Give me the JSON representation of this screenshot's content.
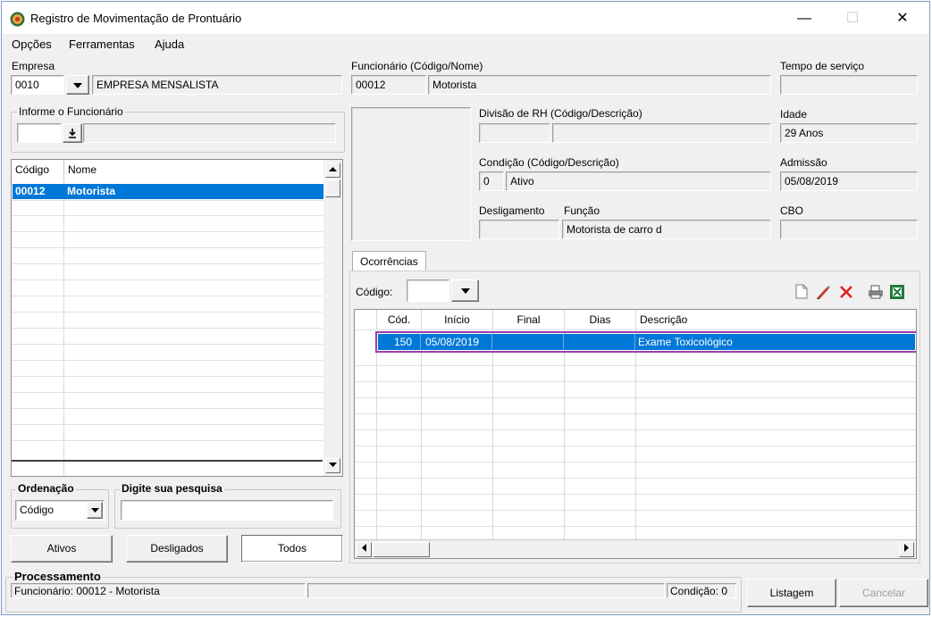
{
  "window": {
    "title": "Registro de Movimentação de Prontuário",
    "minimize": "—",
    "maximize": "☐",
    "close": "✕"
  },
  "menu": [
    "Opções",
    "Ferramentas",
    "Ajuda"
  ],
  "empresa": {
    "label": "Empresa",
    "code": "0010",
    "name": "EMPRESA MENSALISTA"
  },
  "informe": {
    "label": "Informe o Funcionário"
  },
  "employee_list": {
    "headers": [
      "Código",
      "Nome"
    ],
    "rows": [
      {
        "code": "00012",
        "name": "Motorista"
      }
    ]
  },
  "ordenacao": {
    "label": "Ordenação",
    "value": "Código"
  },
  "pesquisa": {
    "label": "Digite sua pesquisa",
    "value": ""
  },
  "filter_buttons": {
    "ativos": "Ativos",
    "desligados": "Desligados",
    "todos": "Todos"
  },
  "funcionario": {
    "label": "Funcionário (Código/Nome)",
    "code": "00012",
    "name": "Motorista"
  },
  "tempo_servico": {
    "label": "Tempo de serviço",
    "value": ""
  },
  "divisao": {
    "label": "Divisão de RH (Código/Descrição)",
    "code": "",
    "desc": ""
  },
  "idade": {
    "label": "Idade",
    "value": "29 Anos"
  },
  "condicao": {
    "label": "Condição (Código/Descrição)",
    "code": "0",
    "desc": "Ativo"
  },
  "admissao": {
    "label": "Admissão",
    "value": "05/08/2019"
  },
  "desligamento": {
    "label": "Desligamento",
    "value": ""
  },
  "funcao": {
    "label": "Função",
    "value": "Motorista de carro d"
  },
  "cbo": {
    "label": "CBO",
    "value": ""
  },
  "ocorrencias": {
    "tab_label": "Ocorrências",
    "codigo_label": "Código:",
    "codigo_value": "",
    "headers": [
      "Cód.",
      "Início",
      "Final",
      "Dias",
      "Descrição"
    ],
    "rows": [
      {
        "cod": "150",
        "inicio": "05/08/2019",
        "final": "",
        "dias": "",
        "descricao": "Exame Toxicológico"
      }
    ]
  },
  "processamento": {
    "label": "Processamento",
    "status": "Funcionário: 00012 - Motorista",
    "condicao": "Condição: 0"
  },
  "bottom_buttons": {
    "listagem": "Listagem",
    "cancelar": "Cancelar"
  },
  "colors": {
    "selection": "#0078d7",
    "highlight_border": "#9b3fa6",
    "window_bg": "#f0f0f0"
  }
}
